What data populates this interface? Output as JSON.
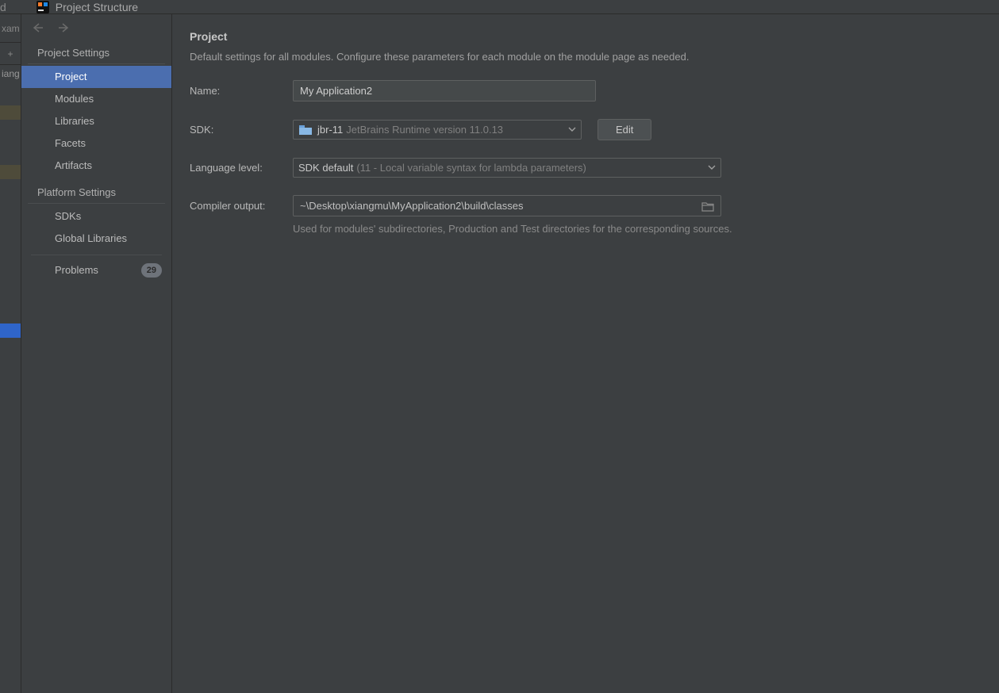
{
  "titlebar": {
    "partial_left": "d",
    "title": "Project Structure"
  },
  "left_strip": {
    "top_text": "xam",
    "tool": "+",
    "tab_text": "iang"
  },
  "sidebar": {
    "section_project": "Project Settings",
    "items_project": [
      {
        "label": "Project",
        "selected": true
      },
      {
        "label": "Modules",
        "selected": false
      },
      {
        "label": "Libraries",
        "selected": false
      },
      {
        "label": "Facets",
        "selected": false
      },
      {
        "label": "Artifacts",
        "selected": false
      }
    ],
    "section_platform": "Platform Settings",
    "items_platform": [
      {
        "label": "SDKs"
      },
      {
        "label": "Global Libraries"
      }
    ],
    "problems_label": "Problems",
    "problems_count": "29"
  },
  "content": {
    "title": "Project",
    "desc": "Default settings for all modules. Configure these parameters for each module on the module page as needed.",
    "name_label": "Name:",
    "name_value": "My Application2",
    "sdk_label": "SDK:",
    "sdk_name": "jbr-11",
    "sdk_version": "JetBrains Runtime version 11.0.13",
    "edit_btn": "Edit",
    "lang_label": "Language level:",
    "lang_default": "SDK default",
    "lang_detail": "(11 - Local variable syntax for lambda parameters)",
    "compiler_label": "Compiler output:",
    "compiler_value": "~\\Desktop\\xiangmu\\MyApplication2\\build\\classes",
    "compiler_hint": "Used for modules' subdirectories, Production and Test directories for the corresponding sources."
  }
}
